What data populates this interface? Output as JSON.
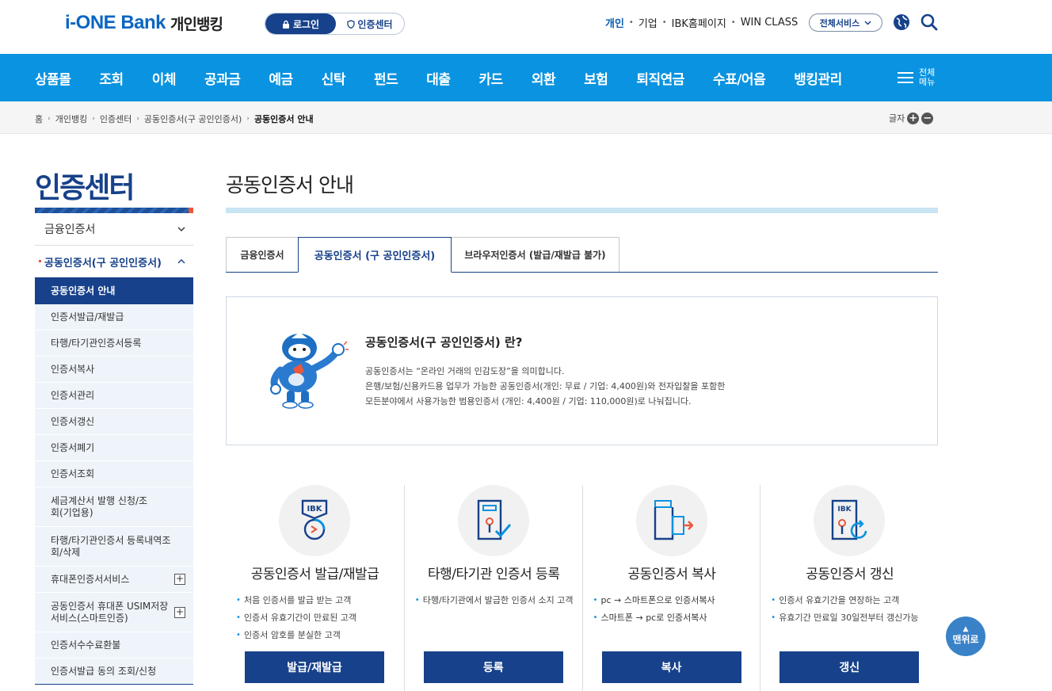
{
  "header": {
    "logo_brand": "i-ONE Bank",
    "logo_sub": "개인뱅킹",
    "login_label": "로그인",
    "cert_center_label": "인증센터",
    "top_links": [
      "개인",
      "기업",
      "IBK홈페이지",
      "WIN CLASS"
    ],
    "all_service_label": "전체서비스"
  },
  "nav": {
    "items": [
      "상품몰",
      "조회",
      "이체",
      "공과금",
      "예금",
      "신탁",
      "펀드",
      "대출",
      "카드",
      "외환",
      "보험",
      "퇴직연금",
      "수표/어음",
      "뱅킹관리"
    ],
    "all_menu_label": "전체 메뉴"
  },
  "breadcrumb": {
    "items": [
      "홈",
      "개인뱅킹",
      "인증센터",
      "공동인증서(구 공인인증서)"
    ],
    "current": "공동인증서 안내",
    "font_label": "글자"
  },
  "sidebar": {
    "title": "인증센터",
    "groups": [
      {
        "label": "금융인증서"
      },
      {
        "label": "공동인증서(구 공인인증서)"
      }
    ],
    "sub_items": [
      "공동인증서 안내",
      "인증서발급/재발급",
      "타행/타기관인증서등록",
      "인증서복사",
      "인증서관리",
      "인증서갱신",
      "인증서폐기",
      "인증서조회",
      "세금계산서 발행 신청/조회(기업용)",
      "타행/타기관인증서 등록내역조회/삭제",
      "휴대폰인증서서비스",
      "공동인증서 휴대폰 USIM저장서비스(스마트인증)",
      "인증서수수료환불",
      "인증서발급 동의 조회/신청"
    ]
  },
  "main": {
    "title": "공동인증서 안내",
    "tabs": [
      "금융인증서",
      "공동인증서 (구 공인인증서)",
      "브라우저인증서 (발급/재발급 불가)"
    ],
    "intro": {
      "title": "공동인증서(구 공인인증서) 란?",
      "lines": [
        "공동인증서는 “온라인 거래의 인감도장”을 의미합니다.",
        "은행/보험/신용카드용 업무가 가능한 공동인증서(개인: 무료 / 기업: 4,400원)와 전자입찰을 포함한",
        "모든분야에서 사용가능한 범용인증서 (개인: 4,400원 / 기업: 110,000원)로 나눠집니다."
      ]
    },
    "cards": [
      {
        "title": "공동인증서 발급/재발급",
        "items": [
          "처음 인증서를 발급 받는 고객",
          "인증서 유효기간이 만료된 고객",
          "인증서 암호를 분실한 고객"
        ],
        "button": "발급/재발급"
      },
      {
        "title": "타행/타기관 인증서 등록",
        "items": [
          "타행/타기관에서 발급한 인증서 소지 고객"
        ],
        "button": "등록"
      },
      {
        "title": "공동인증서 복사",
        "items": [
          "pc → 스마트폰으로 인증서복사",
          "스마트폰 → pc로 인증서복사"
        ],
        "button": "복사"
      },
      {
        "title": "공동인증서 갱신",
        "items": [
          "인증서 유효기간을 연장하는 고객",
          "유효기간 만료일 30일전부터 갱신가능"
        ],
        "button": "갱신"
      }
    ]
  },
  "top_button_label": "맨위로",
  "colors": {
    "brand_navy": "#17418a",
    "nav_blue": "#0a93e0",
    "accent_red": "#e8583b"
  }
}
